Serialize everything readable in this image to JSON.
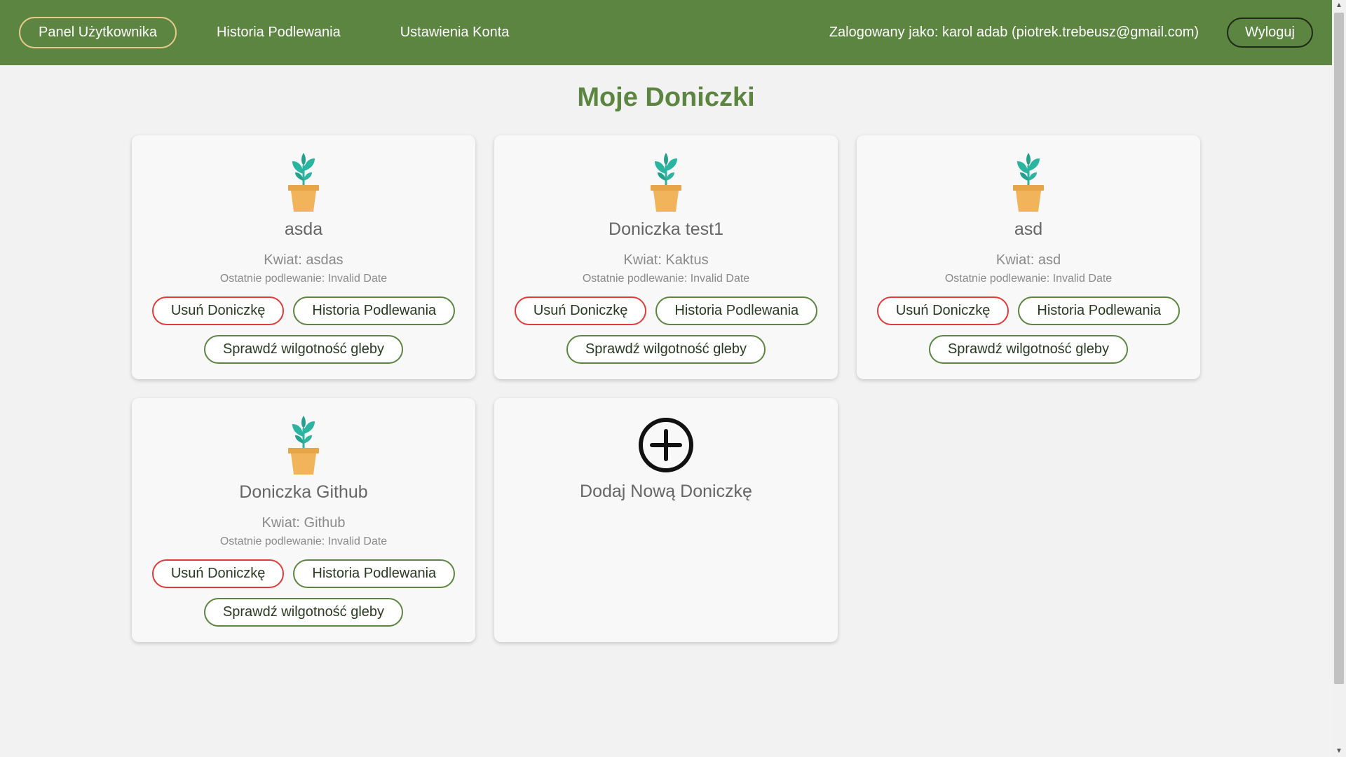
{
  "nav": {
    "items": [
      {
        "label": "Panel Użytkownika",
        "active": true
      },
      {
        "label": "Historia Podlewania",
        "active": false
      },
      {
        "label": "Ustawienia Konta",
        "active": false
      }
    ],
    "user_info": "Zalogowany jako: karol adab (piotrek.trebeusz@gmail.com)",
    "logout_label": "Wyloguj"
  },
  "page_title": "Moje Doniczki",
  "pots": [
    {
      "name": "asda",
      "flower": "Kwiat: asdas",
      "last_watering": "Ostatnie podlewanie: Invalid Date"
    },
    {
      "name": "Doniczka test1",
      "flower": "Kwiat: Kaktus",
      "last_watering": "Ostatnie podlewanie: Invalid Date"
    },
    {
      "name": "asd",
      "flower": "Kwiat: asd",
      "last_watering": "Ostatnie podlewanie: Invalid Date"
    },
    {
      "name": "Doniczka Github",
      "flower": "Kwiat: Github",
      "last_watering": "Ostatnie podlewanie: Invalid Date"
    }
  ],
  "buttons": {
    "delete": "Usuń Doniczkę",
    "history": "Historia Podlewania",
    "soil": "Sprawdź wilgotność gleby"
  },
  "add_pot_label": "Dodaj Nową Doniczkę",
  "icons": {
    "pot": "potted-plant-icon",
    "add": "plus-circle-icon"
  },
  "colors": {
    "header": "#5c8541",
    "accent_green": "#5c8541",
    "delete_red": "#e03a3a",
    "active_border": "#e6c98b",
    "plant_leaf": "#2bb5a0",
    "pot": "#f2b45a"
  }
}
